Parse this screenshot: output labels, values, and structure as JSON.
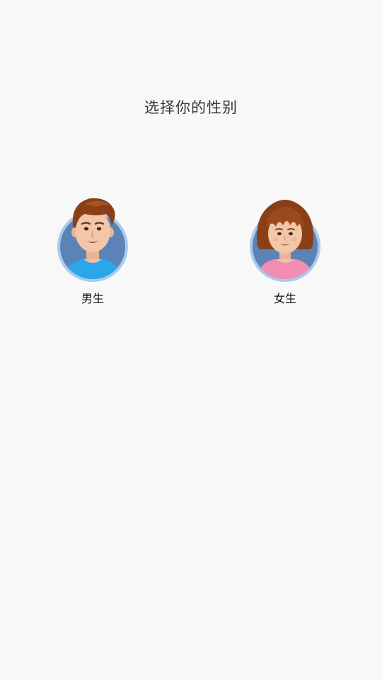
{
  "page": {
    "title": "选择你的性别"
  },
  "options": [
    {
      "label": "男生",
      "avatar_icon": "boy-avatar-icon",
      "ring_color": "#a9c9ee",
      "bg_color": "#5b83b7",
      "shirt_color": "#2aa6ea"
    },
    {
      "label": "女生",
      "avatar_icon": "girl-avatar-icon",
      "ring_color": "#a9c9ee",
      "bg_color": "#5b83b7",
      "shirt_color": "#f28cb0"
    }
  ]
}
